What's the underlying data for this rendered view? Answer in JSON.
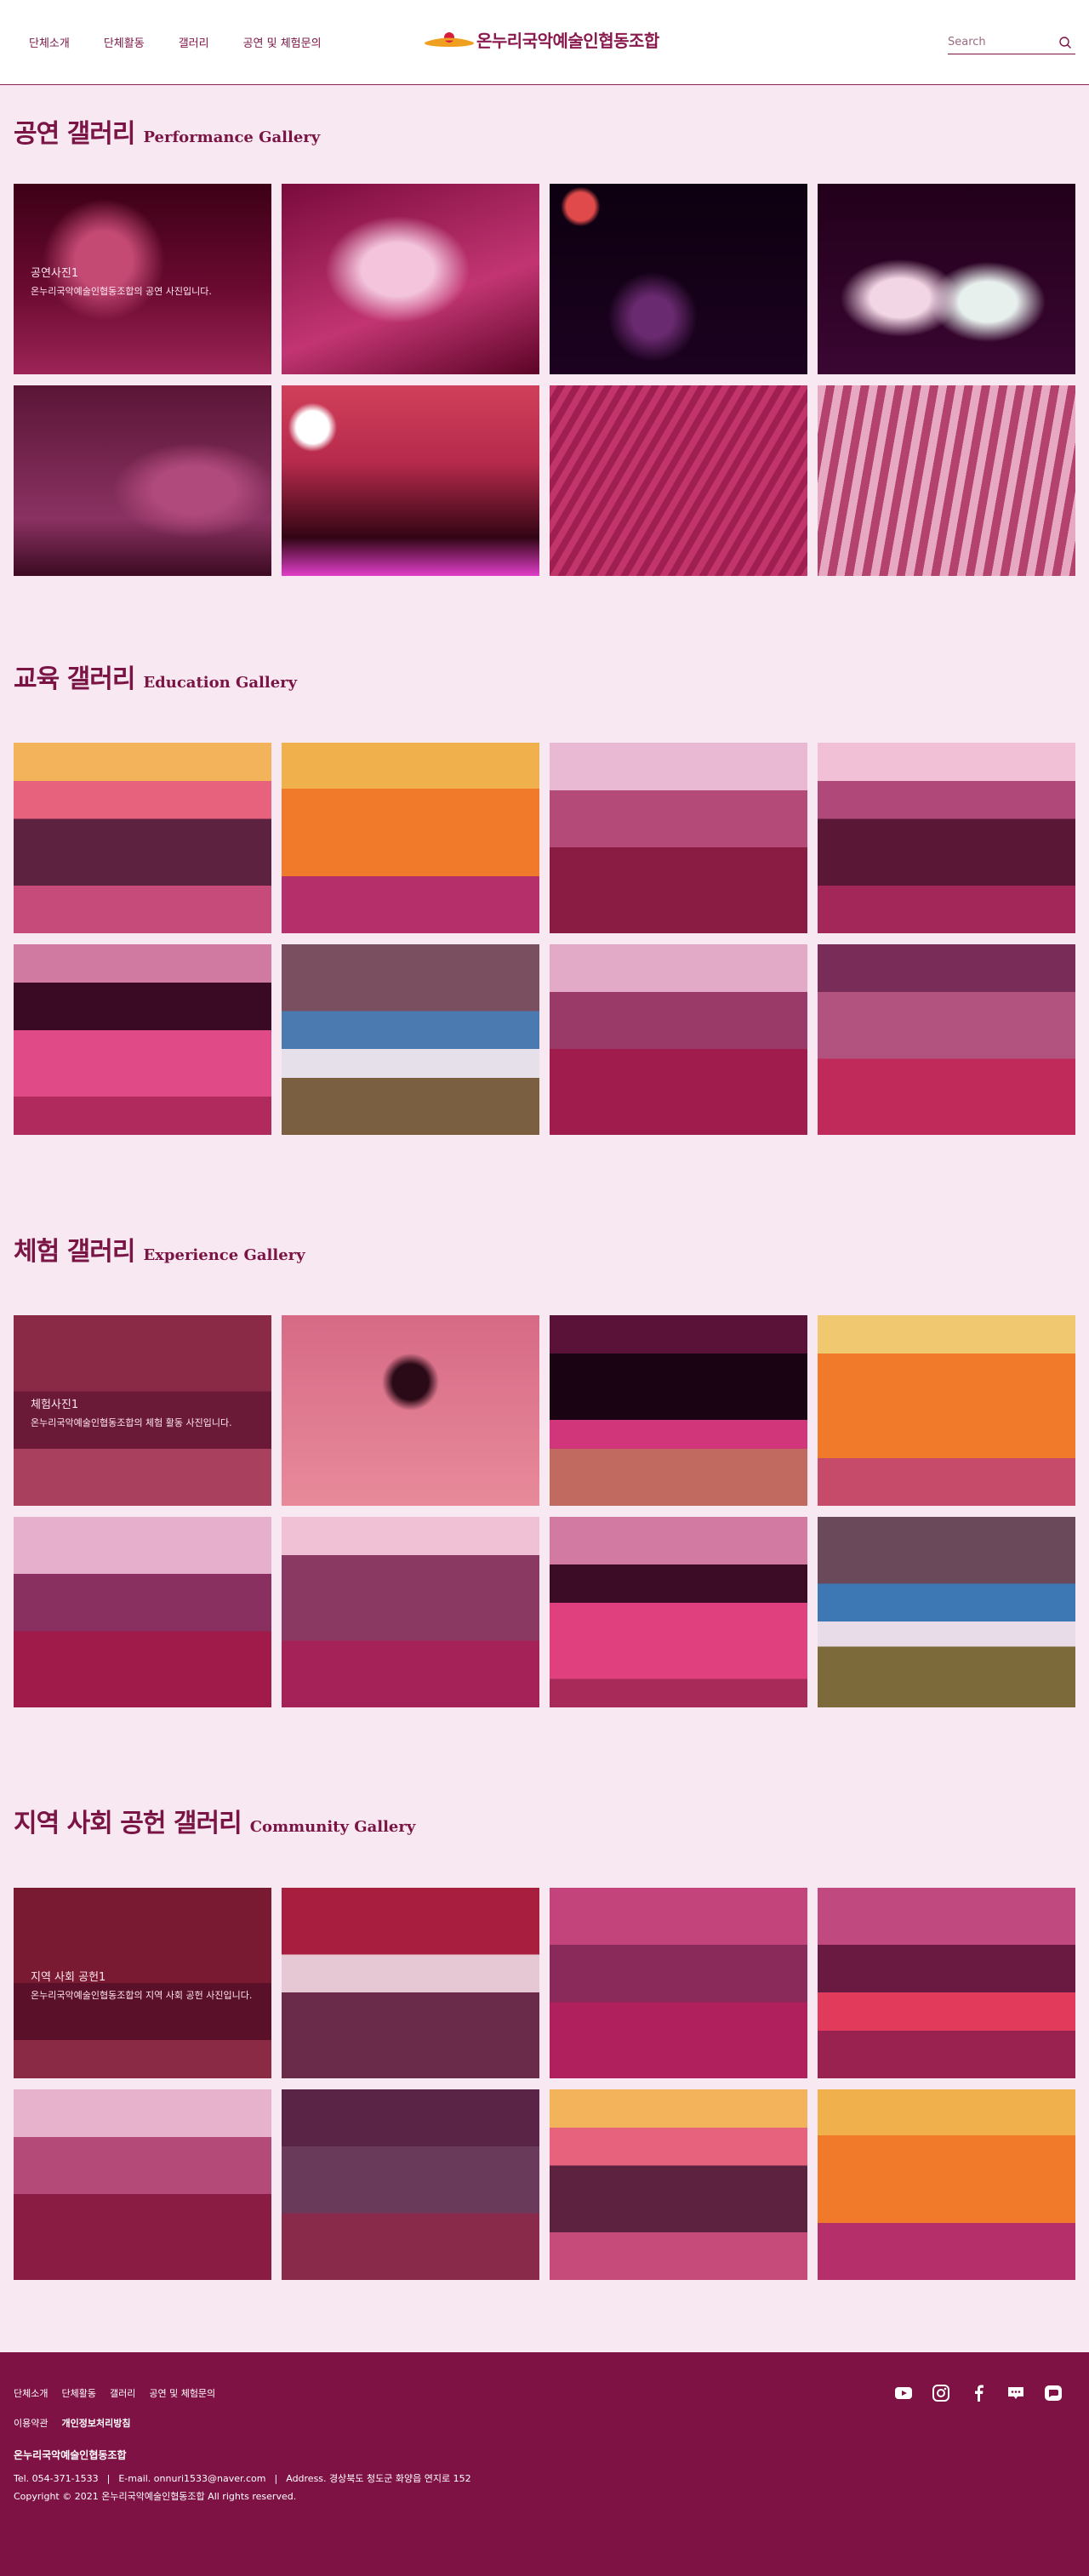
{
  "header": {
    "nav": [
      "단체소개",
      "단체활동",
      "갤러리",
      "공연 및 체험문의"
    ],
    "logo_text": "온누리국악예술인협동조합",
    "search_placeholder": "Search"
  },
  "colors": {
    "brand": "#7e1244",
    "background": "#f8e8f2",
    "accent_orange": "#f0a020",
    "accent_red": "#d61e3c"
  },
  "sections": [
    {
      "title_ko": "공연 갤러리",
      "title_en": "Performance Gallery",
      "overlay": {
        "title": "공연사진1",
        "desc": "온누리국악예술인협동조합의 공연 사진입니다."
      }
    },
    {
      "title_ko": "교육 갤러리",
      "title_en": "Education Gallery"
    },
    {
      "title_ko": "체험 갤러리",
      "title_en": "Experience Gallery",
      "overlay": {
        "title": "체험사진1",
        "desc": "온누리국악예술인협동조합의 체험 활동 사진입니다."
      }
    },
    {
      "title_ko": "지역 사회 공헌 갤러리",
      "title_en": "Community Gallery",
      "overlay": {
        "title": "지역 사회 공헌1",
        "desc": "온누리국악예술인협동조합의 지역 사회 공헌 사진입니다."
      }
    }
  ],
  "footer": {
    "nav": [
      "단체소개",
      "단체활동",
      "갤러리",
      "공연 및 체험문의"
    ],
    "policy": [
      "이용약관",
      "개인정보처리방침"
    ],
    "company": "온누리국악예술인협동조합",
    "tel": "Tel. 054-371-1533",
    "email": "E-mail. onnuri1533@naver.com",
    "address": "Address. 경상북도 청도군 화양읍 연지로 152",
    "copyright": "Copyright © 2021 온누리국악예술인협동조합 All rights reserved.",
    "social_icons": [
      "youtube-icon",
      "instagram-icon",
      "facebook-icon",
      "blog-icon",
      "kakao-channel-icon"
    ]
  }
}
